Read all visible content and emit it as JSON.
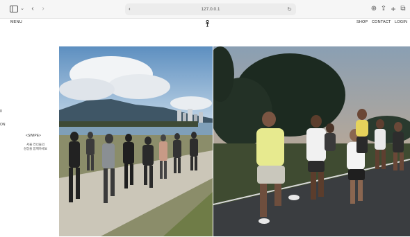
{
  "browser": {
    "url": "127.0.0.1",
    "icons": [
      "sidebar-toggle-icon",
      "chevron-down-icon",
      "back-icon",
      "forward-icon",
      "shield-icon",
      "reload-icon",
      "download-icon",
      "share-icon",
      "new-tab-icon",
      "tabs-overview-icon"
    ]
  },
  "nav": {
    "menu": "MENU",
    "shop": "SHOP",
    "contact": "CONTACT",
    "login": "LOGIN"
  },
  "side": {
    "mark_top": "0",
    "mark_bottom": "ON",
    "swipe": "<SWIPE>",
    "caption_line1": "서울 러너들의",
    "caption_line2": "성장을 함께하세요"
  },
  "colors": {
    "sky": "#9ec0de",
    "asphalt": "#3a3d40",
    "grass": "#6f7c47"
  }
}
